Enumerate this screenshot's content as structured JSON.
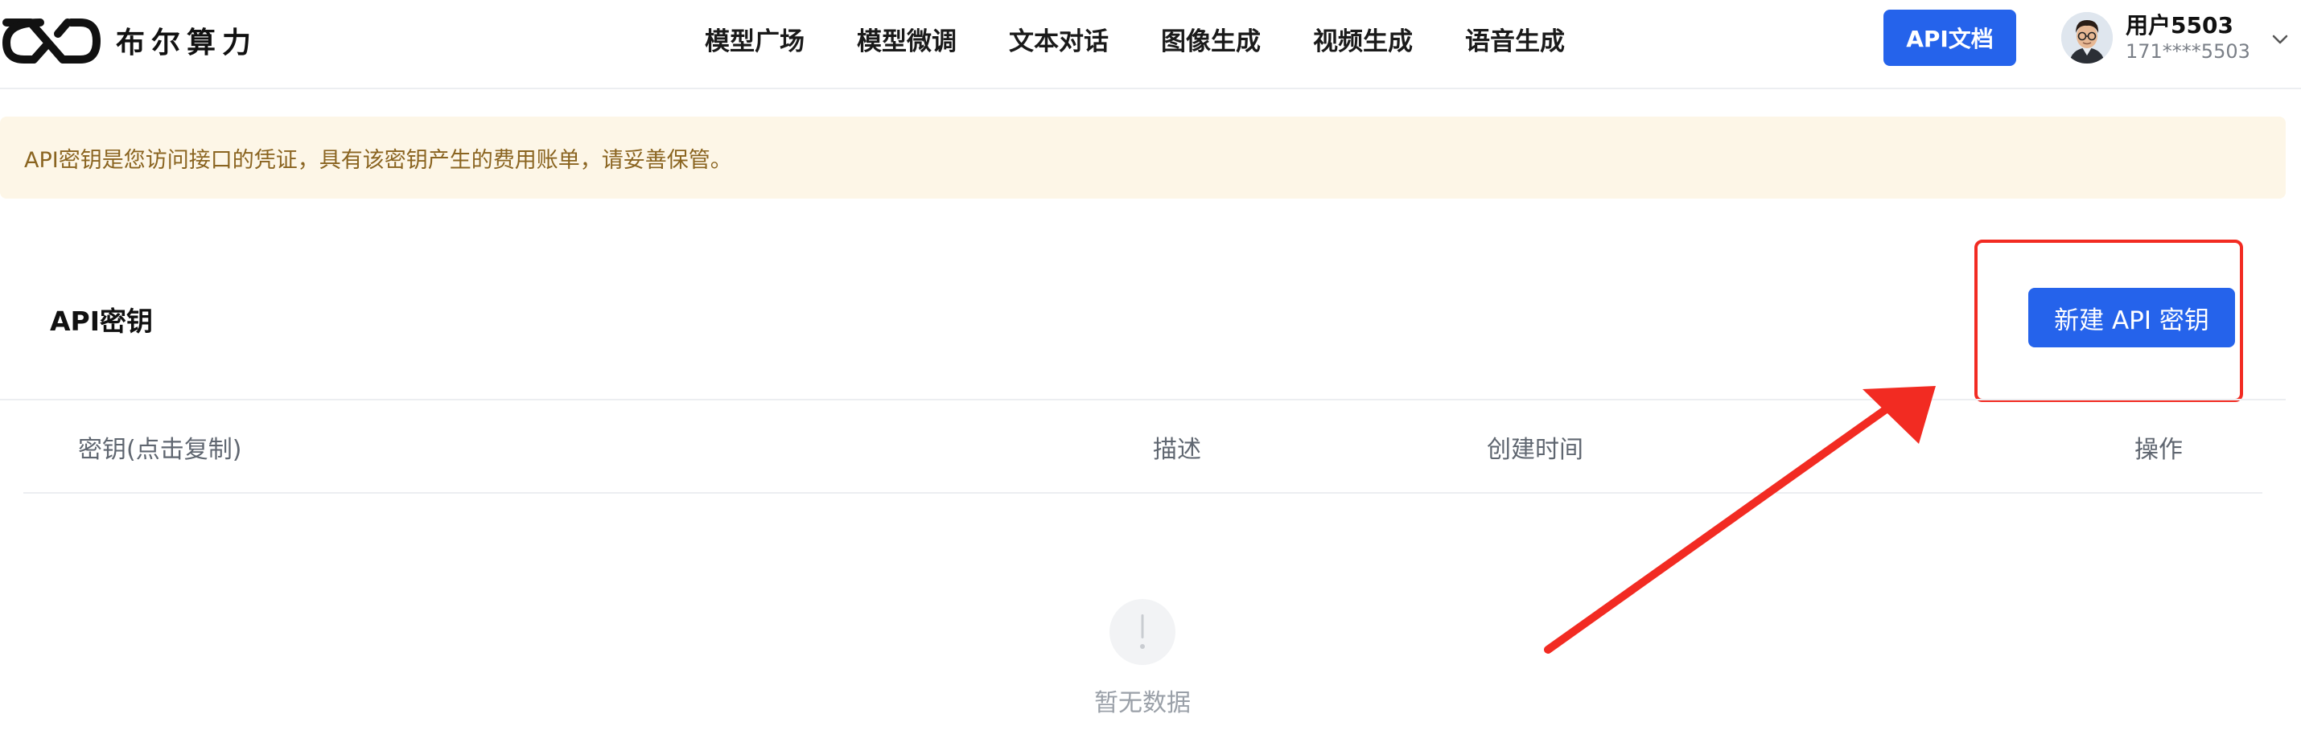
{
  "brand": {
    "name": "布尔算力",
    "logo_icon": "infinity-logo-icon"
  },
  "nav": {
    "items": [
      "模型广场",
      "模型微调",
      "文本对话",
      "图像生成",
      "视频生成",
      "语音生成"
    ]
  },
  "header": {
    "docs_button": "API文档",
    "user_name": "用户5503",
    "user_phone": "171****5503",
    "dropdown_icon": "chevron-down-icon"
  },
  "notice": {
    "text": "API密钥是您访问接口的凭证，具有该密钥产生的费用账单，请妥善保管。"
  },
  "section": {
    "title": "API密钥",
    "new_key_button": "新建 API 密钥"
  },
  "table": {
    "columns": [
      "密钥(点击复制)",
      "描述",
      "创建时间",
      "操作"
    ],
    "rows": [],
    "empty_text": "暂无数据"
  },
  "annotation": {
    "highlight_color": "#f22b22",
    "arrow_color": "#f22b22"
  },
  "colors": {
    "primary": "#2563eb",
    "notice_bg": "#fdf6e7",
    "notice_text": "#8a6420"
  }
}
